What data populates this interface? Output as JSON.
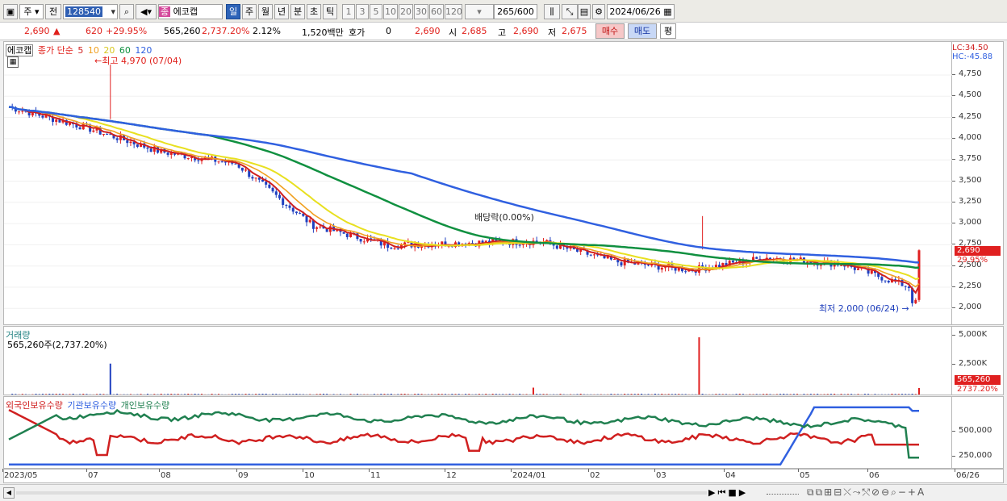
{
  "toolbar": {
    "period_label": "주",
    "prev_label": "전",
    "code": "128540",
    "stock_name": "에코캡",
    "name_tag": "종",
    "interval_tabs": [
      "일",
      "주",
      "월",
      "년",
      "분",
      "초",
      "틱"
    ],
    "interval_numbers": [
      "1",
      "3",
      "5",
      "10",
      "20",
      "30",
      "60",
      "120"
    ],
    "count": "265",
    "count_total": "/600",
    "date": "2024/06/26"
  },
  "quote": {
    "price": "2,690",
    "change": "620",
    "change_pct": "+29.95%",
    "volume": "565,260",
    "volume_pct": "2,737.20%",
    "turnover_pct": "2.12%",
    "amount": "1,520백만",
    "hoga_label": "호가",
    "hoga_value": "0",
    "hoga_price": "2,690",
    "open_label": "시",
    "open": "2,685",
    "high_label": "고",
    "high": "2,690",
    "low_label": "저",
    "low": "2,675",
    "buy_label": "매수",
    "sell_label": "매도",
    "eval_label": "평"
  },
  "price_panel": {
    "legend_name": "에코캡",
    "legend_ma": "종가 단순",
    "ma_periods": [
      "5",
      "10",
      "20",
      "60",
      "120"
    ],
    "ma_colors": [
      "#d02020",
      "#f0a020",
      "#e8e020",
      "#109040",
      "#3060e0"
    ],
    "high_note": "최고 4,970 (07/04)",
    "low_note": "최저 2,000 (06/24)",
    "dividend_note": "배당락(0.00%)",
    "lc": "LC:34.50",
    "hc": "HC:-45.88",
    "y_ticks": [
      "4,750",
      "4,500",
      "4,250",
      "4,000",
      "3,750",
      "3,500",
      "3,250",
      "3,000",
      "2,750",
      "2,500",
      "2,250",
      "2,000"
    ],
    "last_price_label": "2,690",
    "last_pct_label": "29.95%"
  },
  "volume_panel": {
    "title": "거래량",
    "value_text": "565,260주(2,737.20%)",
    "y_ticks": [
      "5,000K",
      "2,500K"
    ],
    "last_label": "565,260",
    "last_pct": "2737.20%"
  },
  "holding_panel": {
    "legend": [
      "외국인보유수량",
      "기관보유수량",
      "개인보유수량"
    ],
    "colors": [
      "#d02020",
      "#3060e0",
      "#208050"
    ],
    "y_ticks": [
      "500,000",
      "250,000"
    ]
  },
  "x_labels": [
    "2023/05",
    "07",
    "08",
    "09",
    "10",
    "11",
    "12",
    "2024/01",
    "02",
    "03",
    "04",
    "05",
    "06",
    "06/26"
  ],
  "chart_data": {
    "type": "line",
    "title": "에코캡",
    "x": [
      "2023/05",
      "2023/07",
      "2023/08",
      "2023/09",
      "2023/10",
      "2023/11",
      "2023/12",
      "2024/01",
      "2024/02",
      "2024/03",
      "2024/04",
      "2024/05",
      "2024/06",
      "2024/06/26"
    ],
    "series": [
      {
        "name": "종가",
        "values": [
          4450,
          4200,
          3900,
          3750,
          3000,
          2750,
          2780,
          2800,
          2550,
          2450,
          2600,
          2520,
          2200,
          2690
        ]
      }
    ],
    "ylim": [
      1900,
      4970
    ],
    "high": {
      "value": 4970,
      "date": "07/04"
    },
    "low": {
      "value": 2000,
      "date": "06/24"
    }
  }
}
